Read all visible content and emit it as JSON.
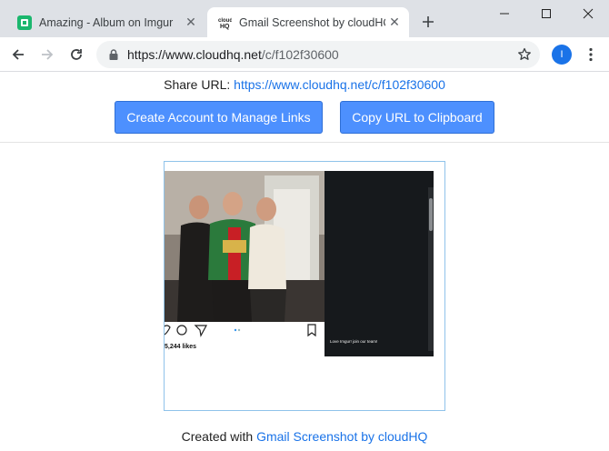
{
  "browser": {
    "tabs": [
      {
        "title": "Amazing - Album on Imgur",
        "active": false,
        "favicon": "imgur-icon"
      },
      {
        "title": "Gmail Screenshot by cloudHQ",
        "active": true,
        "favicon": "cloudhq-icon"
      }
    ],
    "address": {
      "url_host": "https://www.cloudhq.net",
      "url_path": "/c/f102f30600"
    },
    "profile_initial": "I"
  },
  "page": {
    "share_label": "Share URL:",
    "share_url": "https://www.cloudhq.net/c/f102f30600",
    "create_account_label": "Create Account to Manage Links",
    "copy_url_label": "Copy URL to Clipboard",
    "screenshot": {
      "likes_text": "5,244 likes",
      "caption_text": "Love Imgur! join our team!"
    },
    "footer_prefix": "Created with",
    "footer_link": "Gmail Screenshot by cloudHQ"
  },
  "colors": {
    "accent": "#4d90fe",
    "link": "#1a73e8",
    "tabstrip": "#dee1e6"
  }
}
